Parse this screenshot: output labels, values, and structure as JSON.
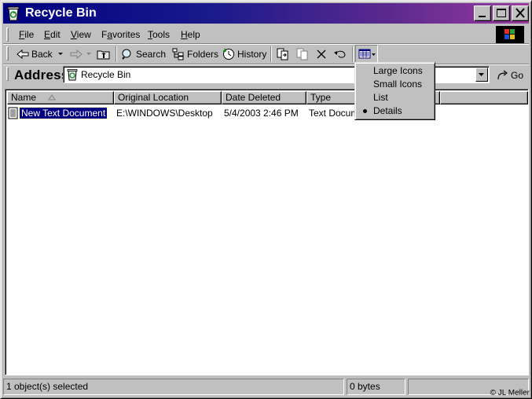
{
  "window": {
    "title": "Recycle Bin"
  },
  "menubar": {
    "items": [
      {
        "label": "File",
        "accel": "F",
        "rest": "ile"
      },
      {
        "label": "Edit",
        "accel": "E",
        "rest": "dit"
      },
      {
        "label": "View",
        "accel": "V",
        "rest": "iew"
      },
      {
        "label": "Favorites",
        "accel": "a",
        "pre": "F",
        "rest": "vorites"
      },
      {
        "label": "Tools",
        "accel": "T",
        "rest": "ools"
      },
      {
        "label": "Help",
        "accel": "H",
        "rest": "elp"
      }
    ]
  },
  "toolbar": {
    "back_label": "Back",
    "search_label": "Search",
    "folders_label": "Folders",
    "history_label": "History",
    "icons": [
      "back-arrow-icon",
      "forward-arrow-icon",
      "up-folder-icon",
      "search-icon",
      "folders-icon",
      "history-icon",
      "move-to-icon",
      "copy-to-icon",
      "delete-icon",
      "undo-icon",
      "views-icon"
    ]
  },
  "address": {
    "label": "Address",
    "value": "Recycle Bin",
    "go_label": "Go"
  },
  "listview": {
    "columns": [
      "Name",
      "Original Location",
      "Date Deleted",
      "Type"
    ],
    "rows": [
      {
        "name": "New Text Document",
        "location": "E:\\WINDOWS\\Desktop",
        "date": "5/4/2003 2:46 PM",
        "type": "Text Document"
      }
    ]
  },
  "views_menu": {
    "items": [
      {
        "label": "Large Icons",
        "checked": false
      },
      {
        "label": "Small Icons",
        "checked": false
      },
      {
        "label": "List",
        "checked": false
      },
      {
        "label": "Details",
        "checked": true
      }
    ]
  },
  "statusbar": {
    "selection": "1 object(s) selected",
    "size": "0 bytes",
    "copyright": "© JL Meller"
  },
  "colors": {
    "title_start": "#000080",
    "title_end": "#9a3aa0",
    "selection": "#000080",
    "face": "#c0c0c0"
  }
}
